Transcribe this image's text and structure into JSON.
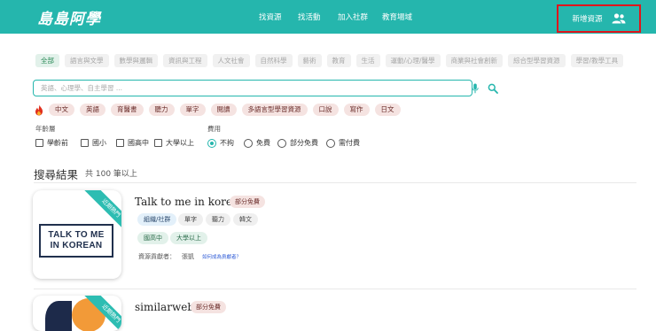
{
  "header": {
    "logo": "島島阿學",
    "nav": [
      "找資源",
      "找活動",
      "加入社群",
      "教育場域"
    ],
    "new_resource": "新增資源"
  },
  "categories": [
    "全部",
    "語言與文學",
    "數學與邏輯",
    "資訊與工程",
    "人文社會",
    "自然科學",
    "藝術",
    "教育",
    "生活",
    "運動/心理/醫學",
    "商業與社會創新",
    "綜合型學習資源",
    "學習/教學工具"
  ],
  "search": {
    "placeholder": "英語、心理學、自主學習 ..."
  },
  "hot_tags": [
    "中文",
    "英語",
    "育醫書",
    "聽力",
    "單字",
    "閱讀",
    "多語言型學習資源",
    "口說",
    "寫作",
    "日文"
  ],
  "filters": {
    "age_label": "年齡層",
    "ages": [
      "學齡前",
      "國小",
      "國高中",
      "大學以上"
    ],
    "fee_label": "費用",
    "fees": [
      "不拘",
      "免費",
      "部分免費",
      "需付費"
    ],
    "fee_selected": "不拘"
  },
  "results": {
    "title": "搜尋結果",
    "count": "共 100 筆以上"
  },
  "cards": [
    {
      "title": "Talk to me in korean",
      "badge": "部分免費",
      "ribbon": "近期熱門",
      "image_text": [
        "TALK TO ME",
        "IN KOREAN"
      ],
      "tags": [
        "組織/社群",
        "單字",
        "聽力",
        "韓文"
      ],
      "levels": [
        "國高中",
        "大學以上"
      ],
      "contributor_label": "資源貢獻者：",
      "contributor": "張凱",
      "link": "如何成為貢獻者？"
    },
    {
      "title": "similarweb",
      "badge": "部分免費",
      "ribbon": "近期熱門"
    }
  ],
  "colors": {
    "brand": "#25b6ad",
    "highlight_border": "#e0151b",
    "tag_bg": "#f5e3e1"
  }
}
